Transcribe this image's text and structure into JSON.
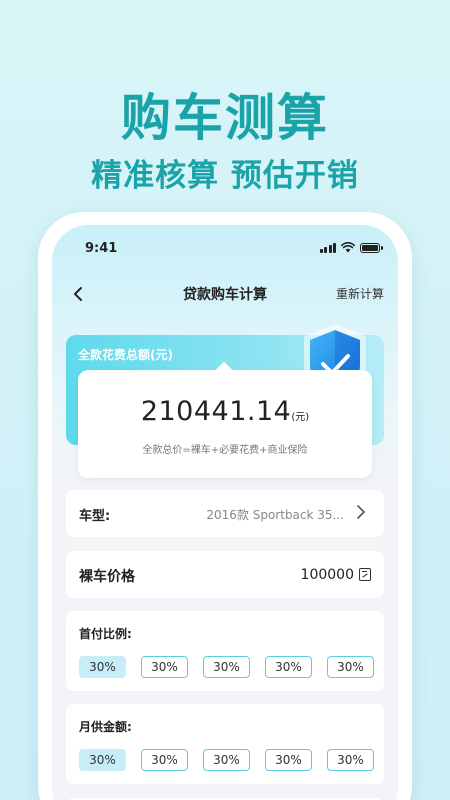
{
  "promo": {
    "title": "购车测算",
    "subtitle": "精准核算  预估开销"
  },
  "status_bar": {
    "time": "9:41"
  },
  "nav": {
    "title": "贷款购车计算",
    "reset_label": "重新计算"
  },
  "total": {
    "label": "全款花费总额(元)",
    "amount": "210441.14",
    "unit": "(元)",
    "note": "全款总价=裸车+必要花费+商业保险"
  },
  "model": {
    "label": "车型:",
    "value": "2016款 Sportback 35..."
  },
  "price": {
    "label": "裸车价格",
    "value": "100000"
  },
  "down_payment": {
    "label": "首付比例:",
    "options": [
      "30%",
      "30%",
      "30%",
      "30%",
      "30%"
    ],
    "selected_index": 0
  },
  "monthly": {
    "label": "月供金额:",
    "options": [
      "30%",
      "30%",
      "30%",
      "30%",
      "30%"
    ],
    "selected_index": 0
  },
  "colors": {
    "accent": "#1aa3a8",
    "card_gradient_start": "#5ed9ec",
    "option_border": "#5ccfdf",
    "option_selected_bg": "#c7eef6"
  }
}
